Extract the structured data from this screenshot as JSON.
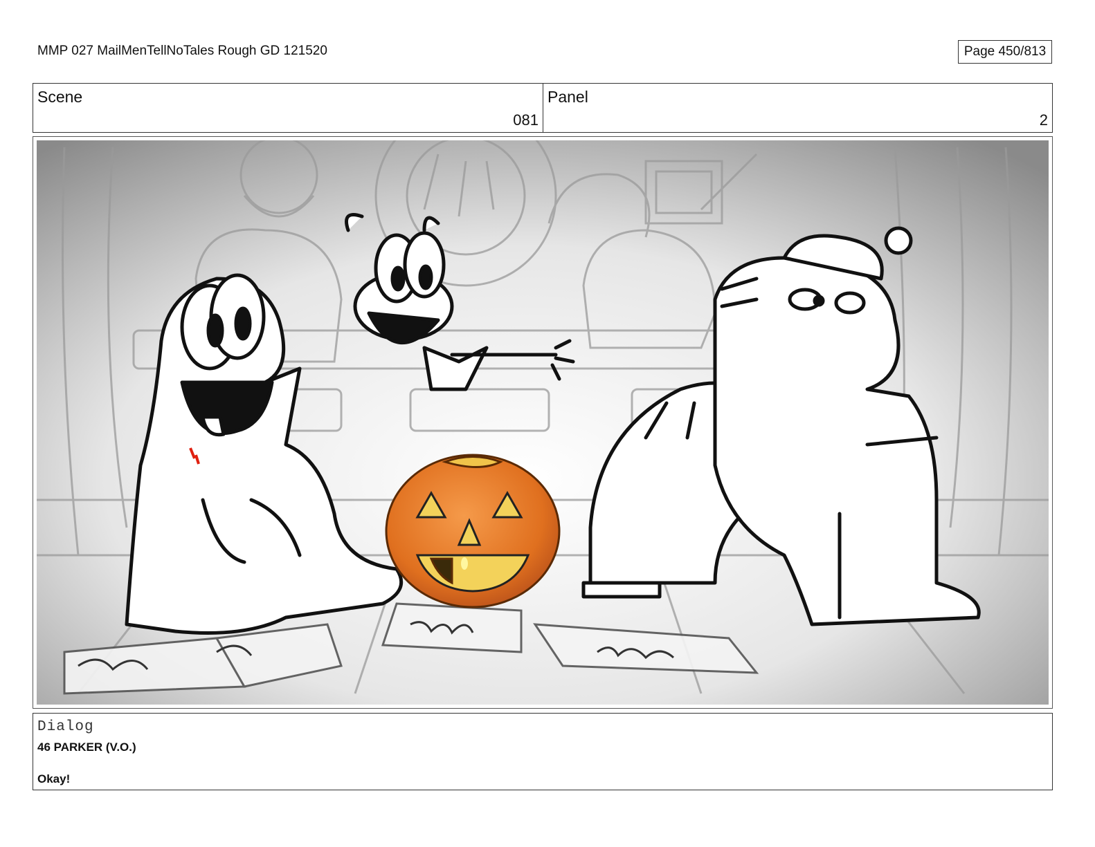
{
  "header": {
    "document_title": "MMP 027 MailMenTellNoTales Rough GD 121520",
    "page_label": "Page 450/813"
  },
  "scene": {
    "label": "Scene",
    "value": "081"
  },
  "panel": {
    "label": "Panel",
    "value": "2"
  },
  "artwork": {
    "pumpkin_color": "#e8782a",
    "sketch_color": "#111111",
    "background_tone": "#d9d9d9",
    "accent_red": "#e02010"
  },
  "dialog": {
    "label": "Dialog",
    "speaker": "46 PARKER (V.O.)",
    "line": "Okay!"
  }
}
